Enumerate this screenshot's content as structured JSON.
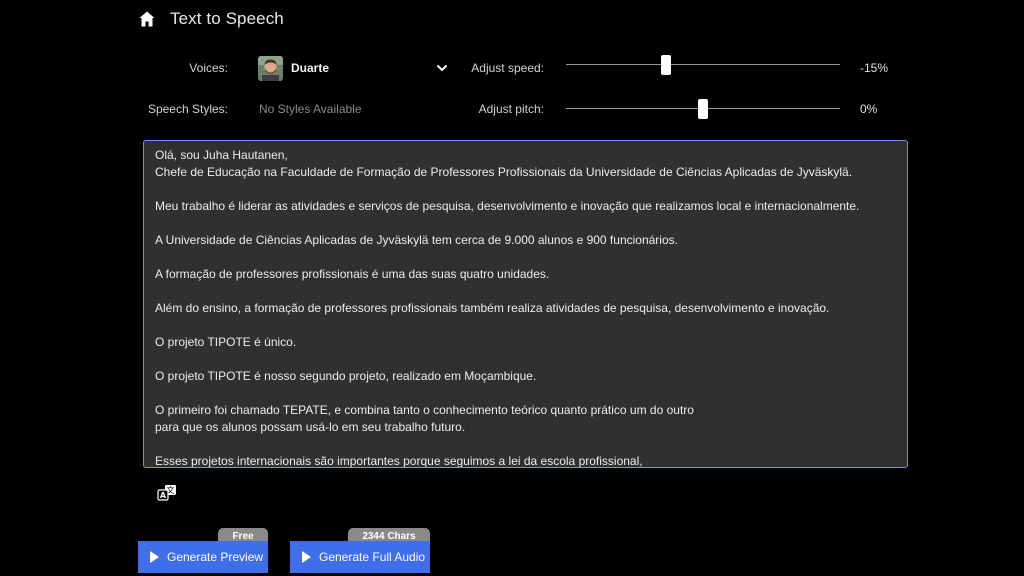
{
  "header": {
    "title": "Text to Speech",
    "icon": "home-icon"
  },
  "voices": {
    "label": "Voices:",
    "selected": "Duarte",
    "icon": "chevron-down-icon"
  },
  "speech_styles": {
    "label": "Speech Styles:",
    "value": "No Styles Available"
  },
  "speed": {
    "label": "Adjust speed:",
    "value": "-15%",
    "level": -0.15
  },
  "pitch": {
    "label": "Adjust pitch:",
    "value": "0%",
    "level": 0
  },
  "text_lines": [
    "Olá, sou Juha Hautanen,",
    "Chefe de Educação na Faculdade de Formação de Professores Profissionais da Universidade de Ciências Aplicadas de Jyväskylä.",
    "",
    "Meu trabalho é liderar as atividades e serviços de pesquisa, desenvolvimento e inovação que realizamos local e internacionalmente.",
    "",
    "A Universidade de Ciências Aplicadas de Jyväskylä tem cerca de 9.000 alunos e 900 funcionários.",
    "",
    "A formação de professores profissionais é uma das suas quatro unidades.",
    "",
    "Além do ensino, a formação de professores profissionais também realiza atividades de pesquisa, desenvolvimento e inovação.",
    "",
    "O projeto TIPOTE é único.",
    "",
    "O projeto TIPOTE é nosso segundo projeto, realizado em Moçambique.",
    "",
    "O primeiro foi chamado TEPATE, e combina tanto o conhecimento teórico quanto prático um do outro",
    "para que os alunos possam usá-lo em seu trabalho futuro.",
    "",
    "Esses projetos internacionais são importantes porque seguimos a lei da escola profissional,"
  ],
  "actions": {
    "translate_icon": "translate-icon",
    "preview": {
      "label": "Generate Preview",
      "badge": "Free"
    },
    "full": {
      "label": "Generate Full Audio",
      "badge": "2344 Chars"
    }
  },
  "colors": {
    "accent": "#3f6fe8",
    "textbox_bg": "#303030",
    "textbox_border": "#6b93e8",
    "badge": "#8a8a8a"
  }
}
